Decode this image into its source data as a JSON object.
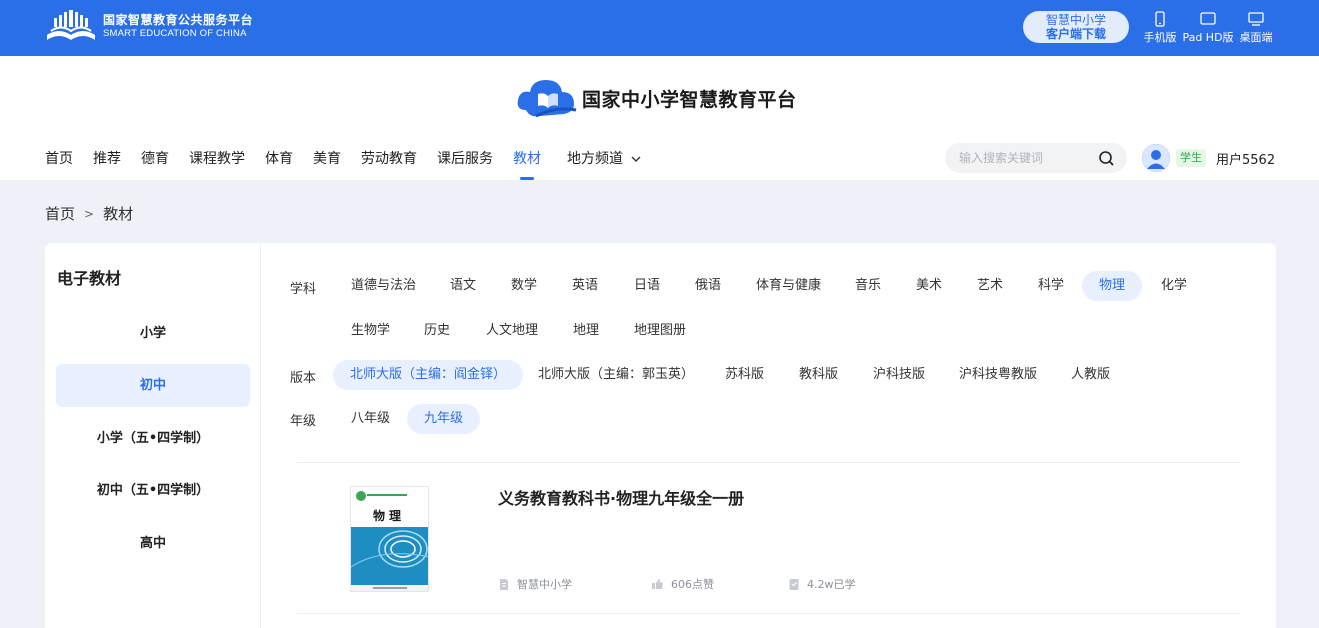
{
  "topbar": {
    "logo_cn": "国家智慧教育公共服务平台",
    "logo_en": "SMART EDUCATION OF CHINA",
    "download_line1": "智慧中小学",
    "download_line2": "客户端下载",
    "devices": [
      {
        "label": "手机版",
        "icon": "phone-icon"
      },
      {
        "label": "Pad HD版",
        "icon": "tablet-icon"
      },
      {
        "label": "桌面端",
        "icon": "desktop-icon"
      }
    ]
  },
  "header": {
    "brand_title": "国家中小学智慧教育平台",
    "nav": [
      "首页",
      "推荐",
      "德育",
      "课程教学",
      "体育",
      "美育",
      "劳动教育",
      "课后服务",
      "教材",
      "地方频道"
    ],
    "active_nav": "教材",
    "search_placeholder": "输入搜索关键词",
    "role_badge": "学生",
    "user_name": "用户5562"
  },
  "breadcrumb": [
    "首页",
    "教材"
  ],
  "sidebar": {
    "title": "电子教材",
    "items": [
      "小学",
      "初中",
      "小学（五•四学制）",
      "初中（五•四学制）",
      "高中"
    ],
    "active": "初中"
  },
  "filters": {
    "subject_label": "学科",
    "subjects": [
      "道德与法治",
      "语文",
      "数学",
      "英语",
      "日语",
      "俄语",
      "体育与健康",
      "音乐",
      "美术",
      "艺术",
      "科学",
      "物理",
      "化学",
      "生物学",
      "历史",
      "人文地理",
      "地理",
      "地理图册"
    ],
    "subject_active": "物理",
    "edition_label": "版本",
    "editions": [
      "北师大版（主编：阎金铎）",
      "北师大版（主编：郭玉英）",
      "苏科版",
      "教科版",
      "沪科技版",
      "沪科技粤教版",
      "人教版"
    ],
    "edition_active": "北师大版（主编：阎金铎）",
    "grade_label": "年级",
    "grades": [
      "八年级",
      "九年级"
    ],
    "grade_active": "九年级"
  },
  "book": {
    "title": "义务教育教科书·物理九年级全一册",
    "cover_title": "物理",
    "publisher": "智慧中小学",
    "likes": "606点赞",
    "learned": "4.2w已学"
  },
  "colors": {
    "primary": "#2b6fe8",
    "active_bg": "#e8efff",
    "page_bg": "#eef1f7"
  }
}
